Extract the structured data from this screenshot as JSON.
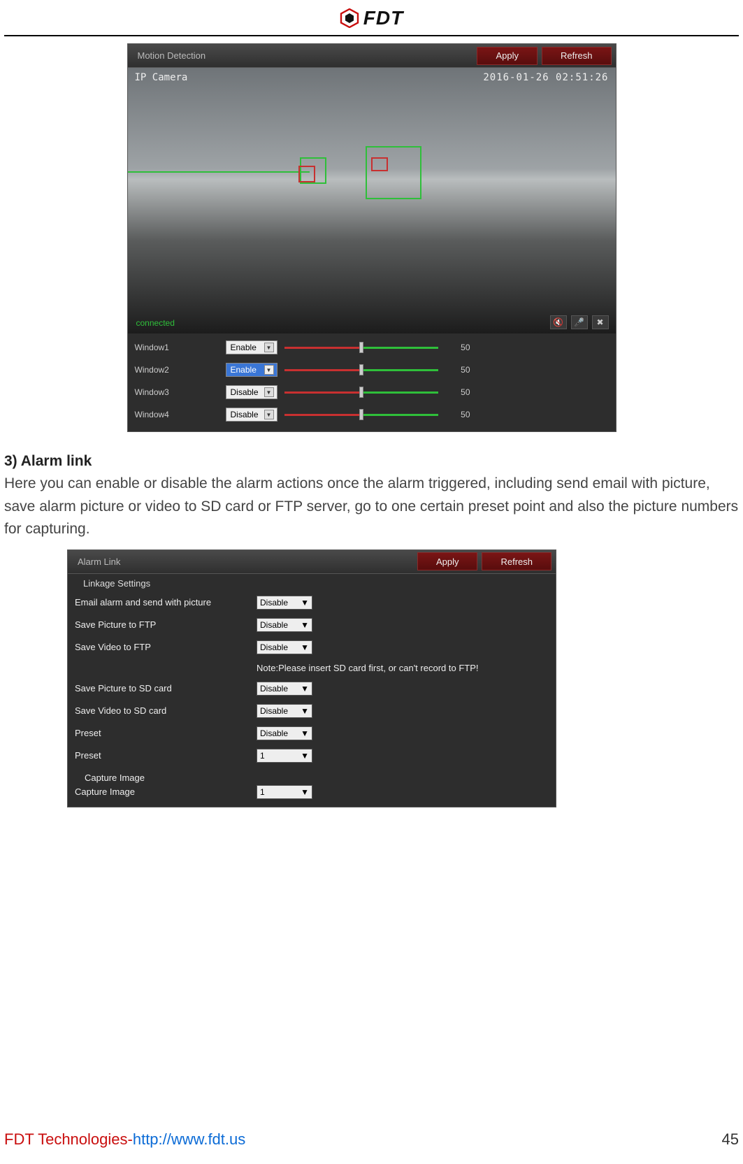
{
  "header": {
    "brand": "FDT"
  },
  "motion_panel": {
    "title": "Motion Detection",
    "apply": "Apply",
    "refresh": "Refresh",
    "camera_label": "IP Camera",
    "timestamp": "2016-01-26 02:51:26",
    "status": "connected",
    "icons": {
      "mute": "mute-icon",
      "mic": "mic-off-icon",
      "tools": "tools-icon"
    },
    "windows": [
      {
        "name": "Window1",
        "mode": "Enable",
        "value": "50"
      },
      {
        "name": "Window2",
        "mode": "Enable",
        "value": "50"
      },
      {
        "name": "Window3",
        "mode": "Disable",
        "value": "50"
      },
      {
        "name": "Window4",
        "mode": "Disable",
        "value": "50"
      }
    ]
  },
  "section": {
    "heading": "3) Alarm link",
    "paragraph": "Here you can enable or disable the alarm actions once the alarm triggered, including send email with picture, save alarm picture or video to SD card or FTP server, go to one certain preset point and also the picture numbers for capturing."
  },
  "alarm_panel": {
    "title": "Alarm Link",
    "apply": "Apply",
    "refresh": "Refresh",
    "sub": "Linkage Settings",
    "note": "Note:Please insert SD card first, or can't record to FTP!",
    "rows": {
      "email": {
        "label": "Email alarm and send with picture",
        "value": "Disable"
      },
      "picftp": {
        "label": "Save Picture to FTP",
        "value": "Disable"
      },
      "vidftp": {
        "label": "Save Video to FTP",
        "value": "Disable"
      },
      "picsd": {
        "label": "Save Picture to SD card",
        "value": "Disable"
      },
      "vidsd": {
        "label": "Save Video to SD card",
        "value": "Disable"
      },
      "preset1": {
        "label": "Preset",
        "value": "Disable"
      },
      "preset2": {
        "label": "Preset",
        "value": "1"
      },
      "capture_head": "Capture Image",
      "capture": {
        "label": "Capture Image",
        "value": "1"
      }
    }
  },
  "footer": {
    "company": "FDT Technologies-",
    "url": "http://www.fdt.us",
    "page": "45"
  }
}
